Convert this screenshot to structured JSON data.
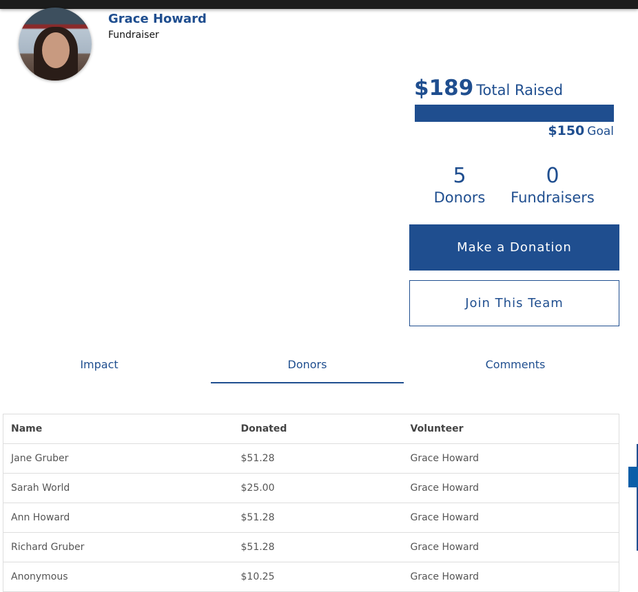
{
  "profile": {
    "name": "Grace Howard",
    "role": "Fundraiser"
  },
  "progress": {
    "raised": "$189",
    "raised_label": "Total Raised",
    "goal": "$150",
    "goal_label": "Goal",
    "fill_percent": 100
  },
  "stats": [
    {
      "value": "5",
      "label": "Donors"
    },
    {
      "value": "0",
      "label": "Fundraisers"
    }
  ],
  "buttons": {
    "donate": "Make a Donation",
    "join": "Join This Team"
  },
  "tabs": [
    {
      "label": "Impact"
    },
    {
      "label": "Donors",
      "active": true
    },
    {
      "label": "Comments"
    }
  ],
  "table": {
    "headers": [
      "Name",
      "Donated",
      "Volunteer"
    ],
    "rows": [
      [
        "Jane Gruber",
        "$51.28",
        "Grace Howard"
      ],
      [
        "Sarah World",
        "$25.00",
        "Grace Howard"
      ],
      [
        "Ann Howard",
        "$51.28",
        "Grace Howard"
      ],
      [
        "Richard Gruber",
        "$51.28",
        "Grace Howard"
      ],
      [
        "Anonymous",
        "$10.25",
        "Grace Howard"
      ]
    ]
  },
  "colors": {
    "brand": "#1f4e8f"
  }
}
